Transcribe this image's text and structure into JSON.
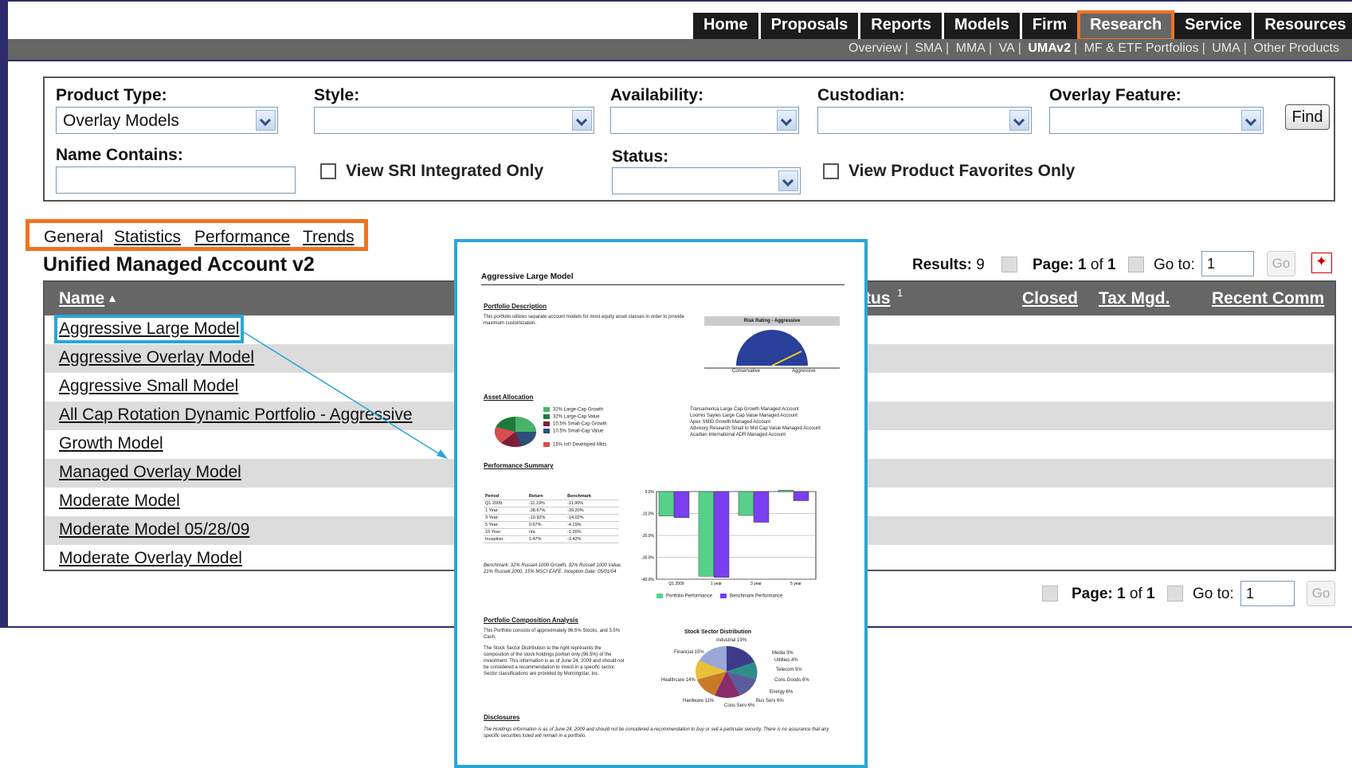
{
  "nav": {
    "tabs": [
      "Home",
      "Proposals",
      "Reports",
      "Models",
      "Firm",
      "Research",
      "Service",
      "Resources"
    ],
    "active_tab": "Research",
    "sublinks": [
      "Overview",
      "SMA",
      "MMA",
      "VA",
      "UMAv2",
      "MF & ETF Portfolios",
      "UMA",
      "Other Products"
    ],
    "current_sublink": "UMAv2"
  },
  "filters": {
    "product_type_label": "Product Type:",
    "product_type_value": "Overlay Models",
    "style_label": "Style:",
    "availability_label": "Availability:",
    "custodian_label": "Custodian:",
    "overlay_label": "Overlay Feature:",
    "find_label": "Find",
    "name_contains_label": "Name Contains:",
    "sri_label": "View SRI Integrated Only",
    "status_label": "Status:",
    "favorites_label": "View Product Favorites Only"
  },
  "view_tabs": [
    "General",
    "Statistics",
    "Performance",
    "Trends"
  ],
  "section_title": "Unified Managed Account v2",
  "results": {
    "label": "Results:",
    "count": "9",
    "page_label": "Page:",
    "page_current": "1",
    "of_label": "of",
    "page_total": "1",
    "goto_label": "Go to:",
    "goto_value": "1",
    "go_label": "Go"
  },
  "table": {
    "columns": [
      "Name",
      "tus",
      "Closed",
      "Tax Mgd.",
      "Recent Comm"
    ],
    "status_footnote": "1",
    "rows": [
      "Aggressive Large Model",
      "Aggressive Overlay Model",
      "Aggressive Small Model",
      "All Cap Rotation Dynamic Portfolio - Aggressive",
      "Growth Model",
      "Managed Overlay Model",
      "Moderate Model",
      "Moderate Model 05/28/09",
      "Moderate Overlay Model"
    ]
  },
  "report": {
    "title": "Aggressive Large Model",
    "portfolio_description_heading": "Portfolio Description",
    "portfolio_description_text": "This portfolio utilizes separate account models for most equity asset classes in order to provide maximum customization.",
    "risk_rating_label": "Risk Rating - Aggressive",
    "risk_left": "Conservative",
    "risk_right": "Aggressive",
    "asset_allocation_heading": "Asset Allocation",
    "allocation_legend": [
      {
        "label": "32% Large-Cap Growth",
        "color": "#49b26a"
      },
      {
        "label": "32% Large-Cap Value",
        "color": "#1e7a3a"
      },
      {
        "label": "10.5% Small-Cap Growth",
        "color": "#7a1f3a"
      },
      {
        "label": "10.5% Small-Cap Value",
        "color": "#2c4f7a"
      },
      {
        "label": "15% Int'l Developed Mkts",
        "color": "#d84e4e"
      }
    ],
    "allocation_managers": [
      "Transamerica Large Cap Growth Managed Account",
      "Loomis Sayles Large Cap Value Managed Account",
      "Apex SMID Growth Managed Account",
      "Advisory Research Small to Mid Cap Value Managed Account",
      "Acadian International ADR Managed Account"
    ],
    "performance_heading": "Performance Summary",
    "perf_headers": [
      "Period",
      "Return",
      "Benchmark"
    ],
    "perf_rows": [
      [
        "Q1 2009:",
        "-11.19%",
        "-11.90%"
      ],
      [
        "1 Year:",
        "-38.67%",
        "-39.20%"
      ],
      [
        "3 Year:",
        "-10.92%",
        "-14.02%"
      ],
      [
        "5 Year:",
        "0.67%",
        "-4.19%"
      ],
      [
        "10 Year:",
        "n/a",
        "-1.26%"
      ],
      [
        "Inception:",
        "1.47%",
        "-3.42%"
      ]
    ],
    "benchmark_note": "Benchmark: 32% Russell 1000 Growth, 32% Russell 1000 Value, 21% Russell 2000, 15% MSCI EAFE. Inception Date: 05/01/04",
    "chart_legend": [
      "Portfolio Performance",
      "Benchmark Performance"
    ],
    "composition_heading": "Portfolio Composition Analysis",
    "composition_text_1": "This Portfolio consists of approximately 96.5% Stocks, and 3.5% Cash.",
    "composition_text_2": "The Stock Sector Distribution to the right represents the composition of the stock holdings portion only (96.5%) of the investment. This information is as of June 24, 2009 and should not be considered a recommendation to invest in a specific sector. Sector classifications are provided by Morningstar, Inc.",
    "sector_title": "Stock Sector Distribution",
    "sector_labels": [
      "Industrial 19%",
      "Media 3%",
      "Utilities 4%",
      "Telecom 5%",
      "Cons Goods 6%",
      "Energy 6%",
      "Bus Serv 6%",
      "Cons Serv 6%",
      "Hardware 11%",
      "Healthcare 14%",
      "Financial 15%"
    ],
    "disclosures_heading": "Disclosures",
    "disclosures_text": "The Holdings information is as of June 24, 2009 and should not be considered a recommendation to buy or sell a particular security. There is no assurance that any specific securities listed will remain in a portfolio."
  },
  "chart_data": {
    "type": "bar",
    "categories": [
      "Q1 2009",
      "1 year",
      "3 year",
      "5 year"
    ],
    "series": [
      {
        "name": "Portfolio Performance",
        "values": [
          -11.19,
          -38.67,
          -10.92,
          0.67
        ]
      },
      {
        "name": "Benchmark Performance",
        "values": [
          -11.9,
          -39.2,
          -14.02,
          -4.19
        ]
      }
    ],
    "ylim": [
      -40,
      0
    ],
    "yticks": [
      "0.0%",
      "-10.0%",
      "-20.0%",
      "-30.0%",
      "-40.0%"
    ],
    "colors": [
      "#57d18a",
      "#7a3ff0"
    ]
  }
}
